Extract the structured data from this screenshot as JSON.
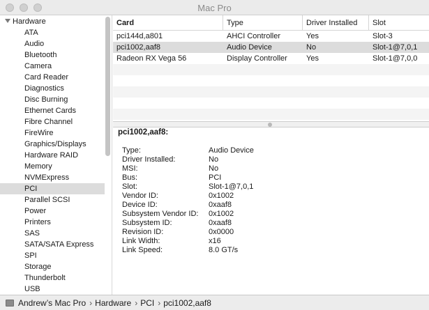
{
  "window": {
    "title": "Mac Pro"
  },
  "sidebar": {
    "group_label": "Hardware",
    "items": [
      {
        "label": "ATA"
      },
      {
        "label": "Audio"
      },
      {
        "label": "Bluetooth"
      },
      {
        "label": "Camera"
      },
      {
        "label": "Card Reader"
      },
      {
        "label": "Diagnostics"
      },
      {
        "label": "Disc Burning"
      },
      {
        "label": "Ethernet Cards"
      },
      {
        "label": "Fibre Channel"
      },
      {
        "label": "FireWire"
      },
      {
        "label": "Graphics/Displays"
      },
      {
        "label": "Hardware RAID"
      },
      {
        "label": "Memory"
      },
      {
        "label": "NVMExpress"
      },
      {
        "label": "PCI",
        "selected": true
      },
      {
        "label": "Parallel SCSI"
      },
      {
        "label": "Power"
      },
      {
        "label": "Printers"
      },
      {
        "label": "SAS"
      },
      {
        "label": "SATA/SATA Express"
      },
      {
        "label": "SPI"
      },
      {
        "label": "Storage"
      },
      {
        "label": "Thunderbolt"
      },
      {
        "label": "USB"
      }
    ]
  },
  "table": {
    "columns": [
      "Card",
      "Type",
      "Driver Installed",
      "Slot"
    ],
    "rows": [
      [
        "pci144d,a801",
        "AHCI Controller",
        "Yes",
        "Slot-3"
      ],
      [
        "pci1002,aaf8",
        "Audio Device",
        "No",
        "Slot-1@7,0,1"
      ],
      [
        "Radeon RX Vega 56",
        "Display Controller",
        "Yes",
        "Slot-1@7,0,0"
      ]
    ],
    "selected_row": 1
  },
  "detail": {
    "title": "pci1002,aaf8:",
    "properties": [
      {
        "key": "Type:",
        "value": "Audio Device"
      },
      {
        "key": "Driver Installed:",
        "value": "No"
      },
      {
        "key": "MSI:",
        "value": "No"
      },
      {
        "key": "Bus:",
        "value": "PCI"
      },
      {
        "key": "Slot:",
        "value": "Slot-1@7,0,1"
      },
      {
        "key": "Vendor ID:",
        "value": "0x1002"
      },
      {
        "key": "Device ID:",
        "value": "0xaaf8"
      },
      {
        "key": "Subsystem Vendor ID:",
        "value": "0x1002"
      },
      {
        "key": "Subsystem ID:",
        "value": "0xaaf8"
      },
      {
        "key": "Revision ID:",
        "value": "0x0000"
      },
      {
        "key": "Link Width:",
        "value": "x16"
      },
      {
        "key": "Link Speed:",
        "value": "8.0 GT/s"
      }
    ]
  },
  "statusbar": {
    "separator": "›",
    "path": [
      "Andrew’s Mac Pro",
      "Hardware",
      "PCI",
      "pci1002,aaf8"
    ]
  }
}
